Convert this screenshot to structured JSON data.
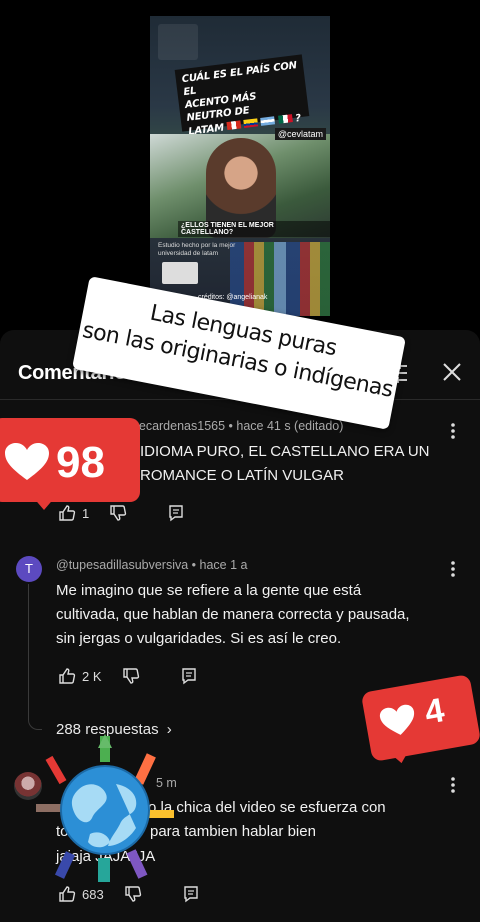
{
  "video": {
    "headline_lines": [
      "CUÁL ES EL PAÍS CON EL",
      "ACENTO MÁS NEUTRO DE",
      "LATAM"
    ],
    "headline_suffix": "?",
    "handle": "@cevlatam",
    "caption": "¿ELLOS TIENEN EL MEJOR CASTELLANO?",
    "study_line1": "Estudio hecho por la mejor",
    "study_line2": "universidad de latam",
    "credits": "créditos: @angelianak"
  },
  "sticker": {
    "line1": "Las lenguas puras",
    "line2": "son las originarias o indígenas"
  },
  "panel": {
    "title": "Comentarios"
  },
  "comments": [
    {
      "author_meta": "@franklinquispecardenas1565 • hace 41 s (editado)",
      "line1": "IDIOMA PURO, EL CASTELLANO ERA UN",
      "line2": "ROMANCE O LATÍN VULGAR",
      "likes": "1"
    },
    {
      "avatar_letter": "T",
      "author_meta": "@tupesadillasubversiva • hace 1 a",
      "line1": "Me imagino que se refiere a la gente que está",
      "line2": "cultivada, que hablan de manera correcta y pausada,",
      "line3": "sin jergas o vulgaridades. Si es así le creo.",
      "likes": "2 K",
      "replies": "288 respuestas"
    },
    {
      "author_meta": "5 m",
      "line1": "o la chica del video se esfuerza con",
      "line2": "para tambien hablar bien",
      "line2_prefix": "to",
      "line3": "jajaja JAJAJJA",
      "likes": "683"
    }
  ],
  "badges": {
    "big_count": "98",
    "small_count": "4"
  },
  "colors": {
    "badge_red": "#e53935",
    "avatar_purple": "#5c4ac0",
    "panel_bg": "#0f0f0f"
  }
}
